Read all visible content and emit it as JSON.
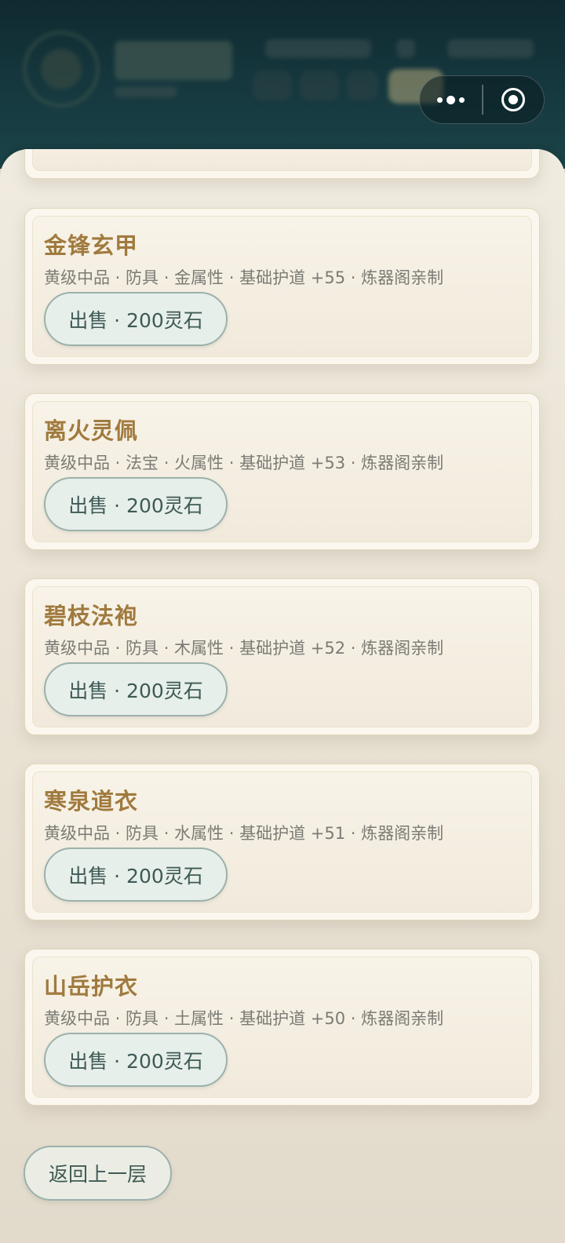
{
  "capsule": {
    "more_icon": "more-dots-icon",
    "close_icon": "mini-program-close-icon"
  },
  "items": [
    {
      "name": "金锋玄甲",
      "desc": "黄级中品 · 防具 · 金属性 · 基础护道 +55 · 炼器阁亲制",
      "sell_label": "出售 · 200灵石"
    },
    {
      "name": "离火灵佩",
      "desc": "黄级中品 · 法宝 · 火属性 · 基础护道 +53 · 炼器阁亲制",
      "sell_label": "出售 · 200灵石"
    },
    {
      "name": "碧枝法袍",
      "desc": "黄级中品 · 防具 · 木属性 · 基础护道 +52 · 炼器阁亲制",
      "sell_label": "出售 · 200灵石"
    },
    {
      "name": "寒泉道衣",
      "desc": "黄级中品 · 防具 · 水属性 · 基础护道 +51 · 炼器阁亲制",
      "sell_label": "出售 · 200灵石"
    },
    {
      "name": "山岳护衣",
      "desc": "黄级中品 · 防具 · 土属性 · 基础护道 +50 · 炼器阁亲制",
      "sell_label": "出售 · 200灵石"
    }
  ],
  "back_label": "返回上一层",
  "colors": {
    "item_name": "#a07a3e",
    "button_text": "#3f5a55",
    "header_bg": "#0f2a30"
  }
}
